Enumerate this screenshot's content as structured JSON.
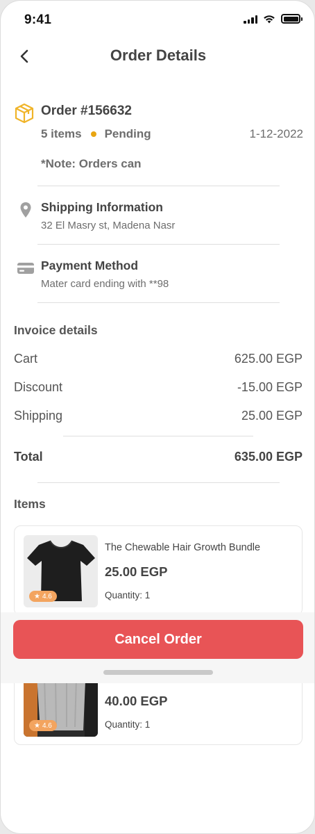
{
  "status_bar": {
    "time": "9:41"
  },
  "header": {
    "title": "Order Details"
  },
  "order": {
    "title": "Order #156632",
    "items_count": "5 items",
    "status": "Pending",
    "status_color": "#e8a512",
    "date": "1-12-2022",
    "note": "*Note: Orders can"
  },
  "shipping": {
    "title": "Shipping Information",
    "address": "32 El Masry st, Madena Nasr"
  },
  "payment": {
    "title": "Payment Method",
    "detail": "Mater card ending with **98"
  },
  "invoice": {
    "title": "Invoice details",
    "rows": [
      {
        "label": "Cart",
        "value": "625.00 EGP"
      },
      {
        "label": "Discount",
        "value": "-15.00 EGP"
      },
      {
        "label": "Shipping",
        "value": "25.00 EGP"
      }
    ],
    "total_label": "Total",
    "total_value": "635.00 EGP"
  },
  "items": {
    "title": "Items",
    "list": [
      {
        "name": "The Chewable Hair Growth Bundle",
        "price": "25.00 EGP",
        "quantity": "Quantity: 1",
        "rating": "4.6"
      },
      {
        "name": "",
        "price": "40.00 EGP",
        "quantity": "Quantity: 1",
        "rating": "4.6"
      }
    ]
  },
  "actions": {
    "cancel_label": "Cancel Order",
    "cancel_color": "#e85456"
  },
  "icons": {
    "back": "chevron-left-icon",
    "order": "package-box-icon",
    "shipping": "location-pin-icon",
    "payment": "credit-card-icon",
    "rating": "star-icon"
  }
}
